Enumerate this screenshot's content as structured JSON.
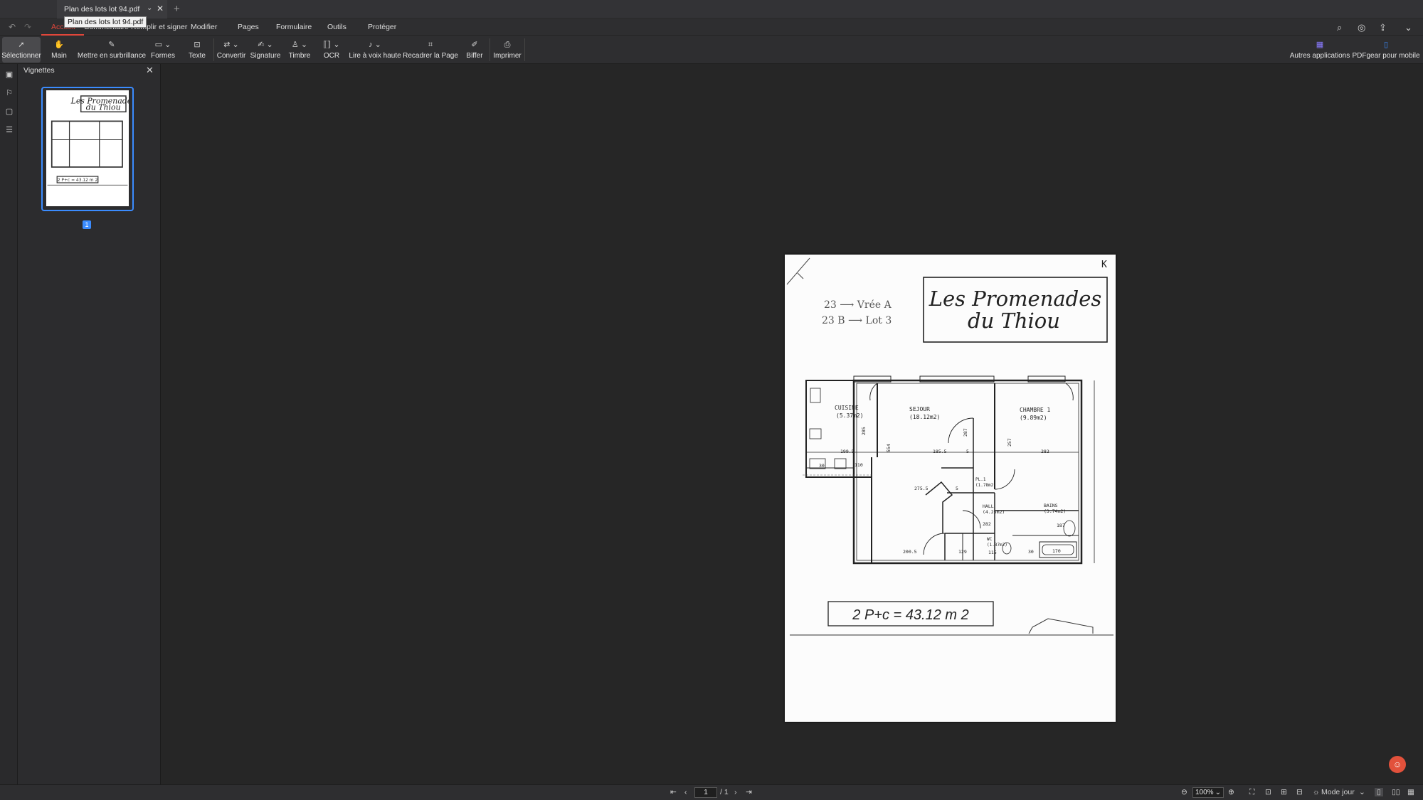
{
  "tabbar": {
    "document_tab": "Plan des lots lot 94.pdf",
    "tooltip": "Plan des lots lot 94.pdf",
    "new_tab_icon": "plus-icon"
  },
  "menubar": {
    "items": [
      "Accueil",
      "Commentaire",
      "Remplir et signer",
      "Modifier",
      "Pages",
      "Formulaire",
      "Outils",
      "Protéger"
    ],
    "active_item": "Accueil",
    "accent_color": "#e0463a"
  },
  "toolbar": {
    "tools": [
      {
        "label": "Sélectionner",
        "icon": "cursor-arrow-icon"
      },
      {
        "label": "Main",
        "icon": "hand-icon"
      },
      {
        "label": "Mettre en surbrillance",
        "icon": "highlighter-icon"
      },
      {
        "label": "Formes",
        "icon": "shapes-icon"
      },
      {
        "label": "Texte",
        "icon": "text-box-icon"
      },
      {
        "label": "Convertir",
        "icon": "convert-icon"
      },
      {
        "label": "Signature",
        "icon": "signature-icon"
      },
      {
        "label": "Timbre",
        "icon": "stamp-icon"
      },
      {
        "label": "OCR",
        "icon": "ocr-icon"
      },
      {
        "label": "Lire à voix haute",
        "icon": "read-aloud-icon"
      },
      {
        "label": "Recadrer la Page",
        "icon": "crop-icon"
      },
      {
        "label": "Biffer",
        "icon": "redact-icon"
      },
      {
        "label": "Imprimer",
        "icon": "printer-icon"
      }
    ],
    "right_tools": [
      {
        "label": "Autres applications",
        "icon": "apps-grid-icon"
      },
      {
        "label": "PDFgear pour mobile",
        "icon": "mobile-icon"
      }
    ]
  },
  "sidebar": {
    "title": "Vignettes",
    "thumbnail_page_number": "1"
  },
  "pdf_page": {
    "title_line1": "Les Promenades",
    "title_line2": "du Thiou",
    "handwritten_line1": "23 ⟶ Vrée A",
    "handwritten_line2": "23 B ⟶ Lot 3",
    "corner_mark": "K",
    "area_summary": "2 P+c = 43.12 m 2",
    "rooms": [
      {
        "name": "CUISINE",
        "area": "(5.37m2)"
      },
      {
        "name": "SEJOUR",
        "area": "(18.12m2)"
      },
      {
        "name": "CHAMBRE 1",
        "area": "(9.89m2)"
      },
      {
        "name": "PL.1",
        "area": "(1.78m2)"
      },
      {
        "name": "HALL",
        "area": "(4.25m2)"
      },
      {
        "name": "BAINS",
        "area": "(3.74m2)"
      },
      {
        "name": "WC",
        "area": "(1.37m2)"
      }
    ],
    "dimensions": [
      "199.5",
      "185.5",
      "282",
      "275.5",
      "282",
      "187",
      "200.5",
      "129",
      "115",
      "170",
      "5",
      "5",
      "30",
      "30",
      "110",
      "287",
      "285",
      "257",
      "554"
    ]
  },
  "statusbar": {
    "current_page": "1",
    "total_pages": "/ 1",
    "zoom": "100%",
    "view_mode": "Mode jour"
  }
}
